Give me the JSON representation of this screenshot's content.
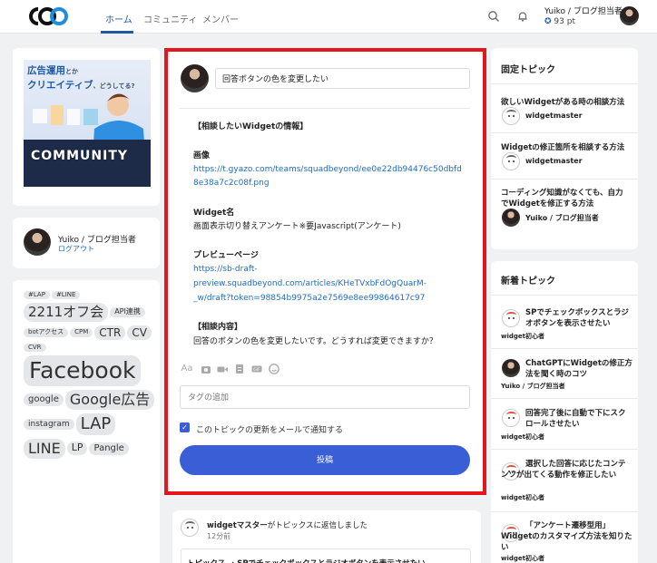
{
  "header": {
    "nav": [
      "ホーム",
      "コミュニティ",
      "メンバー"
    ],
    "user_name": "Yuiko / ブログ担当者",
    "points": "93 pt"
  },
  "banner": {
    "line1": "広告運用",
    "line1_small": "とか",
    "line2": "クリエイティブ",
    "line2_small": "、どうしてる?",
    "community": "COMMUNITY"
  },
  "profile": {
    "name": "Yuiko / ブログ担当者",
    "logout": "ログアウト"
  },
  "tags": [
    {
      "label": "#LAP",
      "size": 7
    },
    {
      "label": "#LINE",
      "size": 7
    },
    {
      "label": "2211オフ会",
      "size": 15
    },
    {
      "label": "API連携",
      "size": 8
    },
    {
      "label": "botアクセス",
      "size": 7
    },
    {
      "label": "CPM",
      "size": 7
    },
    {
      "label": "CTR",
      "size": 12
    },
    {
      "label": "CV",
      "size": 12
    },
    {
      "label": "CVR",
      "size": 7
    },
    {
      "label": "Facebook",
      "size": 25
    },
    {
      "label": "google",
      "size": 10
    },
    {
      "label": "Google広告",
      "size": 16
    },
    {
      "label": "instagram",
      "size": 9
    },
    {
      "label": "LAP",
      "size": 18
    },
    {
      "label": "LINE",
      "size": 16
    },
    {
      "label": "LP",
      "size": 11
    },
    {
      "label": "Pangle",
      "size": 10
    }
  ],
  "composer": {
    "title_value": "回答ボタンの色を変更したい",
    "lines": [
      {
        "text": "【相談したいWidgetの情報】",
        "style": "bold"
      },
      {
        "text": "画像",
        "style": "bold"
      },
      {
        "text": "https://t.gyazo.com/teams/squadbeyond/ee0e22db94476c50dbfd",
        "style": "link"
      },
      {
        "text": "8e38a7c2c08f.png",
        "style": "link"
      },
      {
        "text": "Widget名",
        "style": "bold"
      },
      {
        "text": "画面表示切り替えアンケート※要Javascript(アンケート)",
        "style": "normal"
      },
      {
        "text": "プレビューページ",
        "style": "bold"
      },
      {
        "text": "https://sb-draft-",
        "style": "link"
      },
      {
        "text": "preview.squadbeyond.com/articles/KHeTVxbFdOgQuarM-",
        "style": "link"
      },
      {
        "text": "_w/draft?token=98854b9975a2e7569e8ee99864617c97",
        "style": "link"
      },
      {
        "text": "【相談内容】",
        "style": "bold"
      },
      {
        "text": "回答のボタンの色を変更したいです。どうすれば変更できますか？",
        "style": "normal"
      }
    ],
    "tag_placeholder": "タグの追加",
    "notify_label": "このトピックの更新をメールで通知する",
    "submit_label": "投稿"
  },
  "activity": {
    "user": "widgetマスター",
    "action": "がトピックスに返信しました",
    "time": "12分前",
    "snippet": "トピックス → SPでチェックボックスとラジオボタンを表示させたい"
  },
  "pinned": {
    "title": "固定トピック",
    "items": [
      {
        "title": "欲しいWidgetがある時の相談方法",
        "author": "widgetmaster"
      },
      {
        "title": "Widgetの修正箇所を相談する方法",
        "author": "widgetmaster"
      },
      {
        "title": "コーディング知識がなくても、自力でWidgetを修正する方法",
        "author": "Yuiko / ブログ担当者"
      }
    ]
  },
  "latest": {
    "title": "新着トピック",
    "items": [
      {
        "title": "SPでチェックボックスとラジオボタンを表示させたい",
        "author": "widget初心者"
      },
      {
        "title": "ChatGPTにWidgetの修正方法を聞く時のコツ",
        "author": "Yuiko / ブログ担当者"
      },
      {
        "title": "回答完了後に自動で下にスクロールさせたい",
        "author": "widget初心者"
      },
      {
        "title": "選択した回答に応じたコンテンツが出てくる動作を修正したい",
        "author": "widget初心者"
      },
      {
        "title": "「アンケート遷移型用」Widgetのカスタマイズ方法を知りたい",
        "author": "widget初心者"
      }
    ]
  },
  "colors": {
    "accent": "#3a5ed6",
    "highlight_frame": "#e3161e",
    "nav_active": "#1e5aa8"
  }
}
